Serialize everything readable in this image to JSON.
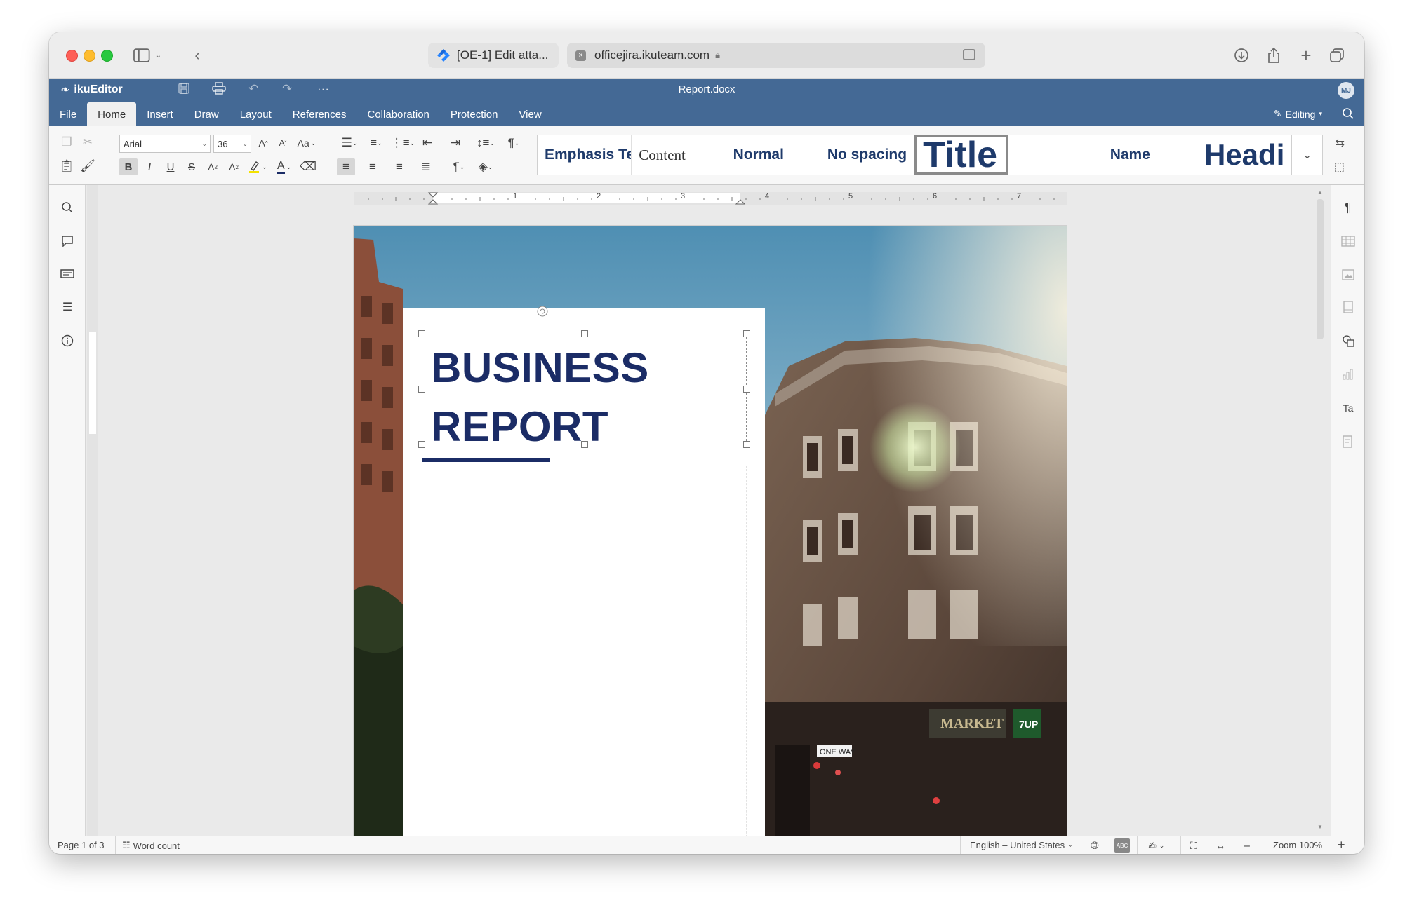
{
  "browser": {
    "tabs": [
      {
        "label": "[OE-1] Edit atta..."
      },
      {
        "label": "officejira.ikuteam.com"
      }
    ]
  },
  "app": {
    "brand": "ikuEditor",
    "document_title": "Report.docx",
    "avatar_initials": "MJ",
    "menu": [
      "File",
      "Home",
      "Insert",
      "Draw",
      "Layout",
      "References",
      "Collaboration",
      "Protection",
      "View"
    ],
    "active_menu": "Home",
    "mode": "Editing"
  },
  "toolbar": {
    "font_family": "Arial",
    "font_size": "36",
    "styles": [
      {
        "label": "Emphasis Te"
      },
      {
        "label": "Content"
      },
      {
        "label": "Normal"
      },
      {
        "label": "No spacing"
      },
      {
        "label": "Title"
      },
      {
        "label": ""
      },
      {
        "label": "Name"
      },
      {
        "label": "Headi"
      }
    ],
    "selected_style": "Title"
  },
  "ruler": {
    "marks": [
      "1",
      "2",
      "3",
      "4",
      "5",
      "6",
      "7"
    ]
  },
  "document": {
    "title_line1": "BUSINESS",
    "title_line2": "REPORT"
  },
  "status": {
    "page": "Page 1 of 3",
    "word_count": "Word count",
    "language": "English – United States",
    "zoom": "Zoom 100%"
  },
  "colors": {
    "header": "#446995",
    "title_text": "#1b2c66",
    "accent": "#1b2c66"
  }
}
